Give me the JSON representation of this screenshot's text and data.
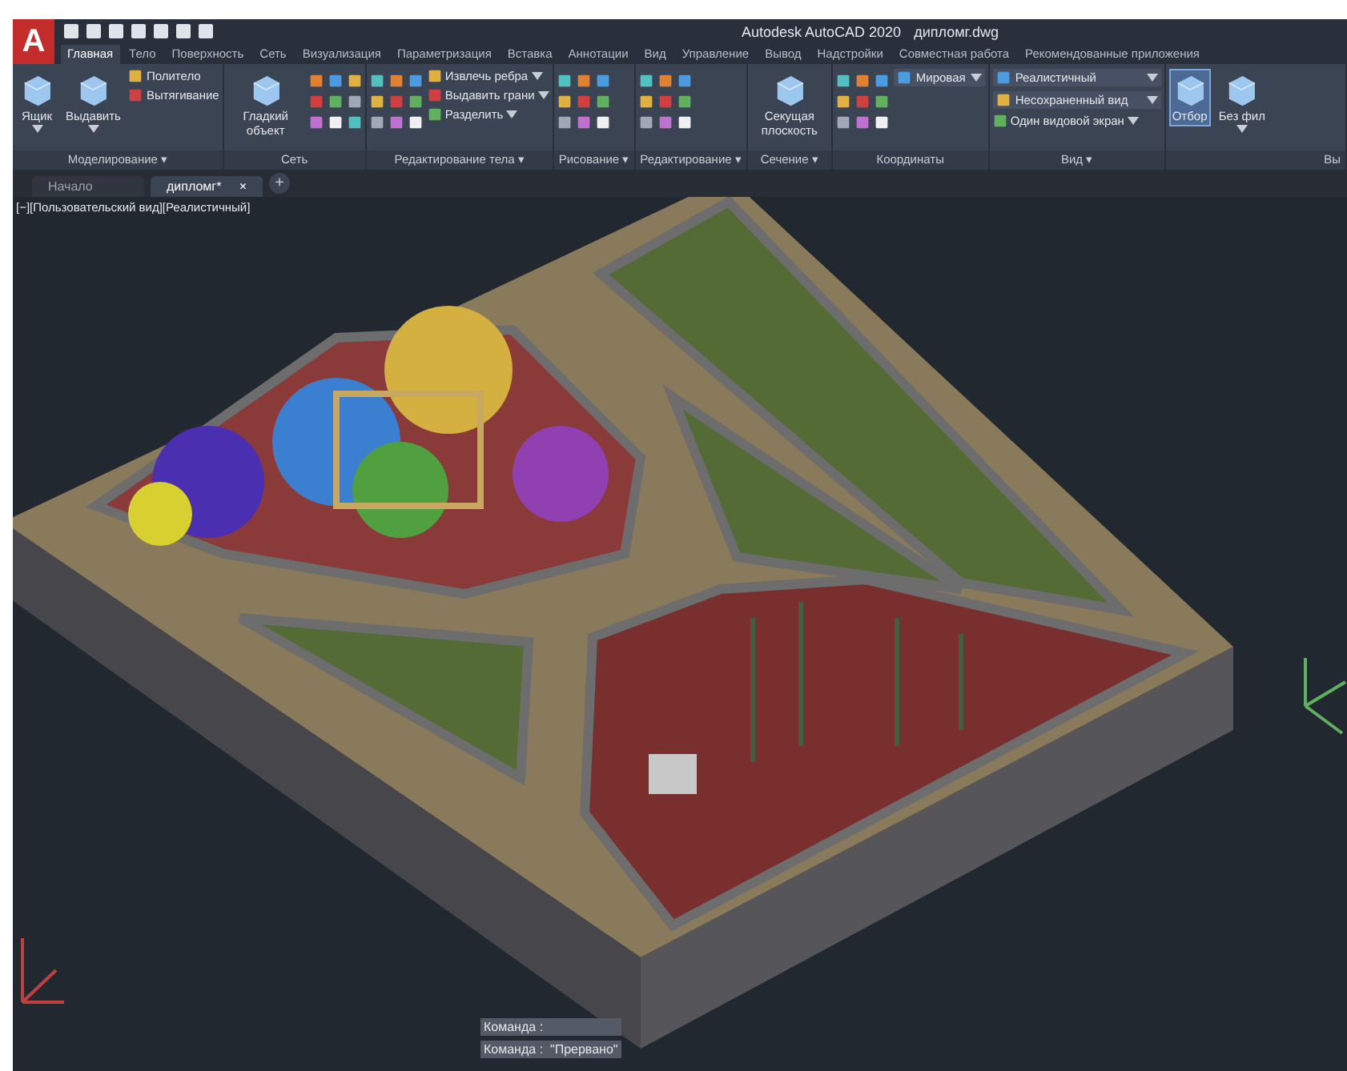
{
  "app_menu": {
    "label": "A"
  },
  "window": {
    "title": "Autodesk AutoCAD 2020",
    "file": "дипломг.dwg"
  },
  "ribbon_tabs": [
    {
      "label": "Главная",
      "selected": true
    },
    {
      "label": "Тело",
      "selected": false
    },
    {
      "label": "Поверхность",
      "selected": false
    },
    {
      "label": "Сеть",
      "selected": false
    },
    {
      "label": "Визуализация",
      "selected": false
    },
    {
      "label": "Параметризация",
      "selected": false
    },
    {
      "label": "Вставка",
      "selected": false
    },
    {
      "label": "Аннотации",
      "selected": false
    },
    {
      "label": "Вид",
      "selected": false
    },
    {
      "label": "Управление",
      "selected": false
    },
    {
      "label": "Вывод",
      "selected": false
    },
    {
      "label": "Надстройки",
      "selected": false
    },
    {
      "label": "Совместная работа",
      "selected": false
    },
    {
      "label": "Рекомендованные приложения",
      "selected": false
    }
  ],
  "panels": [
    {
      "label": "Моделирование ▾",
      "items": [
        {
          "kind": "large",
          "label": "Ящик",
          "caret": true,
          "on": false
        },
        {
          "kind": "large",
          "label": "Выдавить",
          "caret": true,
          "on": false
        },
        {
          "kind": "stack",
          "items": [
            {
              "kind": "small",
              "label": "Политело",
              "caret": false
            },
            {
              "kind": "small",
              "label": "Вытягивание",
              "caret": false
            }
          ]
        }
      ]
    },
    {
      "label": "Сеть",
      "items": [
        {
          "kind": "large",
          "label": "Гладкий объект",
          "caret": false,
          "on": false
        },
        {
          "kind": "icons"
        }
      ]
    },
    {
      "label": "Редактирование тела ▾",
      "items": [
        {
          "kind": "icons"
        },
        {
          "kind": "stack",
          "items": [
            {
              "kind": "small",
              "label": "Извлечь ребра",
              "caret": true
            },
            {
              "kind": "small",
              "label": "Выдавить грани",
              "caret": true
            },
            {
              "kind": "small",
              "label": "Разделить",
              "caret": true
            }
          ]
        }
      ]
    },
    {
      "label": "Рисование ▾",
      "items": [
        {
          "kind": "icons"
        }
      ]
    },
    {
      "label": "Редактирование ▾",
      "items": [
        {
          "kind": "icons"
        }
      ]
    },
    {
      "label": "Сечение ▾",
      "items": [
        {
          "kind": "large",
          "label": "Секущая плоскость",
          "caret": false,
          "on": false
        }
      ]
    },
    {
      "label": "Координаты",
      "items": [
        {
          "kind": "icons"
        },
        {
          "kind": "stack",
          "items": [
            {
              "kind": "dropdown",
              "label": "Мировая"
            }
          ]
        }
      ]
    },
    {
      "label": "Вид ▾",
      "items": [
        {
          "kind": "stack",
          "items": [
            {
              "kind": "dropdown",
              "label": "Реалистичный"
            },
            {
              "kind": "dropdown",
              "label": "Несохраненный вид"
            },
            {
              "kind": "small",
              "label": "Один видовой экран",
              "caret": true
            }
          ]
        }
      ]
    },
    {
      "label": "Вы",
      "items": [
        {
          "kind": "large",
          "label": "Отбор",
          "caret": false,
          "on": true
        },
        {
          "kind": "large",
          "label": "Без фил",
          "caret": true,
          "on": false
        }
      ]
    }
  ],
  "doc_tabs": [
    {
      "label": "Начало",
      "selected": false
    },
    {
      "label": "дипломг*",
      "selected": true,
      "close": "×"
    }
  ],
  "new_tab": "+",
  "viewport": {
    "label": "[−][Пользовательский вид][Реалистичный]"
  },
  "command_lines": [
    "Команда :",
    "Команда :  \"Прервано\""
  ]
}
